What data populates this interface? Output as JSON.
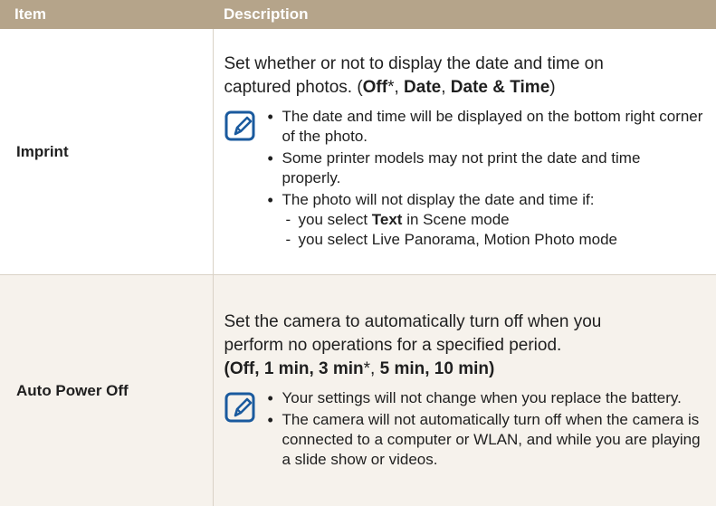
{
  "header": {
    "item": "Item",
    "description": "Description"
  },
  "rows": [
    {
      "item": "Imprint",
      "para": {
        "line1": "Set whether or not to display the date and time on",
        "line2_pre": "captured photos. (",
        "opt1": "Off",
        "opt1_suffix": "*, ",
        "opt2": "Date",
        "sep2": ", ",
        "opt3": "Date & Time",
        "close": ")"
      },
      "notes": [
        "The date and time will be displayed on the bottom right corner of the photo.",
        "Some printer models may not print the date and time properly.",
        "The photo will not display the date and time if:"
      ],
      "subnotes": {
        "s1_pre": "you select ",
        "s1_bold": "Text",
        "s1_post": " in Scene mode",
        "s2": "you select Live Panorama, Motion Photo mode"
      }
    },
    {
      "item": "Auto Power Off",
      "para": {
        "line1": "Set the camera to automatically turn off when you",
        "line2": "perform no operations for a specified period.",
        "open": "(",
        "o1": "Off",
        "s1": ", ",
        "o2": "1 min",
        "s2": ", ",
        "o3": "3 min",
        "s3": "*, ",
        "o4": "5 min",
        "s4": ", ",
        "o5": "10 min",
        "close": ")"
      },
      "notes": [
        "Your settings will not change when you replace the battery.",
        "The camera will not automatically turn off when the camera is connected to a computer or WLAN, and while you are playing a slide show or videos."
      ]
    }
  ],
  "icons": {
    "note": "note-pencil-icon"
  },
  "colors": {
    "header_bg": "#b5a48a",
    "row2_bg": "#f6f2ec",
    "icon_blue": "#1a5a9e"
  }
}
